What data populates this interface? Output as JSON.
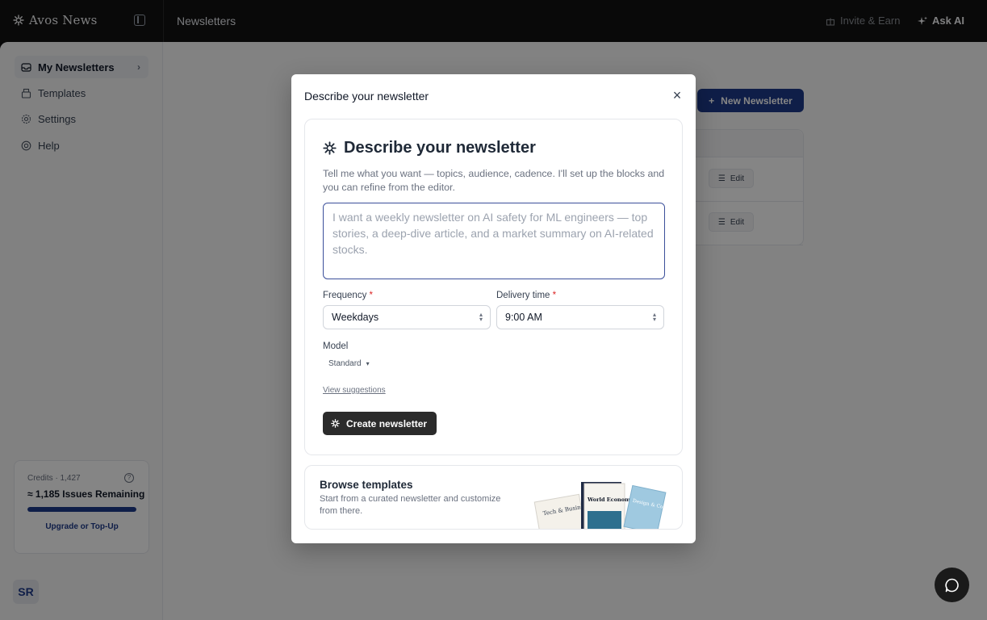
{
  "topbar": {
    "brand": "Avos News",
    "page": "Newsletters",
    "invite": "Invite & Earn",
    "ask_ai": "Ask AI"
  },
  "sidebar": {
    "items": [
      {
        "label": "My Newsletters",
        "icon": "inbox-icon",
        "active": true
      },
      {
        "label": "Templates",
        "icon": "templates-icon",
        "active": false
      },
      {
        "label": "Settings",
        "icon": "gear-icon",
        "active": false
      },
      {
        "label": "Help",
        "icon": "help-icon",
        "active": false
      }
    ],
    "credits": {
      "label": "Credits · 1,427",
      "issues": "≈ 1,185 Issues Remaining",
      "progress": 1.0,
      "upgrade": "Upgrade or Top-Up"
    },
    "avatar": "SR"
  },
  "main": {
    "new_button": "New Newsletter",
    "rows": [
      {
        "edit": "Edit"
      },
      {
        "edit": "Edit"
      }
    ]
  },
  "modal": {
    "title": "Describe your newsletter",
    "heading": "Describe your newsletter",
    "description": "Tell me what you want — topics, audience, cadence. I'll set up the blocks and you can refine from the editor.",
    "prompt_placeholder": "I want a weekly newsletter on AI safety for ML engineers — top stories, a deep-dive article, and a market summary on AI-related stocks.",
    "prompt_value": "",
    "frequency": {
      "label": "Frequency",
      "required": "*",
      "value": "Weekdays"
    },
    "delivery": {
      "label": "Delivery time",
      "required": "*",
      "value": "9:00 AM"
    },
    "model": {
      "label": "Model",
      "value": "Standard"
    },
    "view_suggestions": "View suggestions",
    "create_button": "Create newsletter",
    "browse": {
      "title": "Browse templates",
      "description": "Start from a curated newsletter and customize from there.",
      "books": [
        "Tech & Business",
        "World Economy",
        "Design & Collections"
      ]
    }
  },
  "colors": {
    "accent": "#1e3a8a",
    "topbar": "#121212",
    "required": "#dc2626"
  }
}
